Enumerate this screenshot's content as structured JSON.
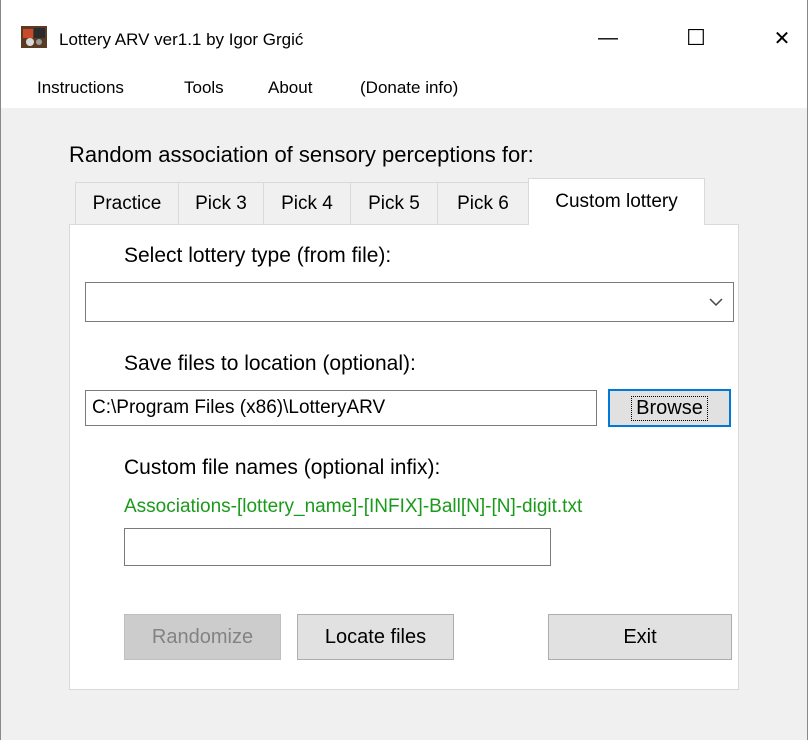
{
  "window": {
    "title": "Lottery ARV ver1.1 by Igor Grgić",
    "minimize_glyph": "—",
    "maximize_glyph": "☐",
    "close_glyph": "✕"
  },
  "menu": [
    "Instructions",
    "Tools",
    "About",
    "(Donate info)"
  ],
  "heading": "Random association of sensory perceptions for:",
  "tabs": [
    "Practice",
    "Pick 3",
    "Pick 4",
    "Pick 5",
    "Pick 6",
    "Custom lottery"
  ],
  "active_tab": "Custom lottery",
  "panel": {
    "select_label": "Select lottery type (from file):",
    "select_value": "",
    "save_label": "Save files to location (optional):",
    "save_path": "C:\\Program Files (x86)\\LotteryARV",
    "browse_label": "Browse",
    "custom_label": "Custom file names (optional infix):",
    "pattern_text": "Associations-[lottery_name]-[INFIX]-Ball[N]-[N]-digit.txt",
    "infix_value": "",
    "randomize_label": "Randomize",
    "locate_label": "Locate files",
    "exit_label": "Exit"
  },
  "colors": {
    "pattern_text": "#1a9a1a",
    "default_button_border": "#0078d7"
  }
}
